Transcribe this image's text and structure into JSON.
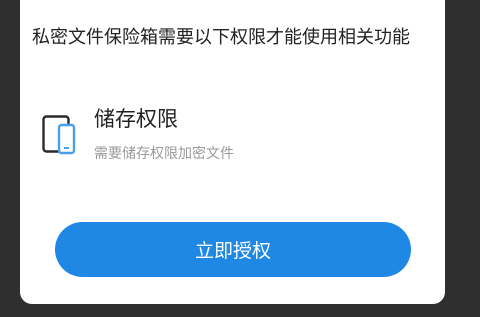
{
  "dialog": {
    "message": "私密文件保险箱需要以下权限才能使用相关功能",
    "permission": {
      "icon": "phone-tablet-icon",
      "title": "储存权限",
      "description": "需要储存权限加密文件"
    },
    "button_label": "立即授权"
  },
  "colors": {
    "accent": "#1f88e5",
    "icon_accent": "#4a9fe8",
    "text_primary": "#222222",
    "text_secondary": "#9a9a9a",
    "backdrop": "#2f2f2f"
  }
}
